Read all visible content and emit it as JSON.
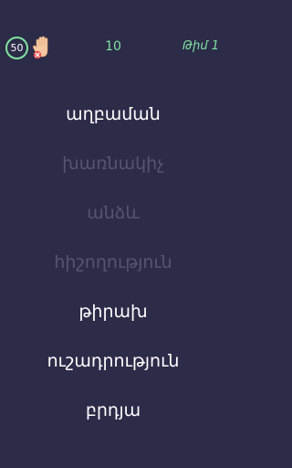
{
  "header": {
    "timer": "50",
    "score": "10",
    "team": "Թիմ 1",
    "skip_icon": "raised-hand-with-x-icon"
  },
  "words": [
    {
      "text": "աղբաման",
      "state": "active"
    },
    {
      "text": "խառնակիչ",
      "state": "faded"
    },
    {
      "text": "անձև",
      "state": "faded"
    },
    {
      "text": "հիշողություն",
      "state": "faded"
    },
    {
      "text": "թիրախ",
      "state": "active"
    },
    {
      "text": "ուշադրություն",
      "state": "active"
    },
    {
      "text": "բրդյա",
      "state": "active"
    }
  ],
  "colors": {
    "background": "#2c2b48",
    "accent": "#7fe3a0",
    "active_text": "#ffffff",
    "faded_text": "#555572",
    "skip_badge": "#e8524f"
  }
}
